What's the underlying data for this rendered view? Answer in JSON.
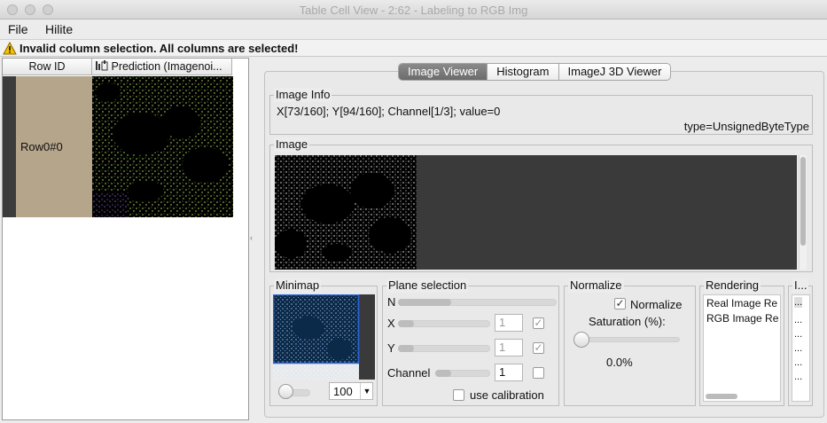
{
  "window": {
    "title": "Table Cell View - 2:62 - Labeling to RGB Img"
  },
  "menu": {
    "items": [
      "File",
      "Hilite"
    ]
  },
  "warning": {
    "text": "Invalid column selection. All columns are selected!"
  },
  "table": {
    "columns": [
      "Row ID",
      "Prediction (Imagenoi..."
    ],
    "rows": [
      {
        "id": "Row0#0"
      }
    ]
  },
  "tabs": {
    "items": [
      "Image Viewer",
      "Histogram",
      "ImageJ 3D Viewer"
    ],
    "selected": 0
  },
  "image_info": {
    "label": "Image Info",
    "line": "X[73/160]; Y[94/160]; Channel[1/3]; value=0",
    "type": "type=UnsignedByteType"
  },
  "image_panel": {
    "label": "Image"
  },
  "minimap": {
    "label": "Minimap",
    "zoom_value": "100"
  },
  "plane_selection": {
    "label": "Plane selection",
    "rows": [
      {
        "name": "N",
        "value": "",
        "checked": false,
        "has_spinner": false
      },
      {
        "name": "X",
        "value": "1",
        "checked": true,
        "has_spinner": true,
        "disabled": true
      },
      {
        "name": "Y",
        "value": "1",
        "checked": true,
        "has_spinner": true,
        "disabled": true
      },
      {
        "name": "Channel",
        "value": "1",
        "checked": false,
        "has_spinner": true,
        "disabled": false
      }
    ],
    "use_calibration_label": "use calibration"
  },
  "normalize": {
    "label": "Normalize",
    "checkbox_label": "Normalize",
    "saturation_label": "Saturation (%):",
    "saturation_value": "0.0%"
  },
  "rendering": {
    "label": "Rendering",
    "items": [
      "Real Image Re",
      "RGB Image Re"
    ]
  },
  "info_panel": {
    "label": "I...",
    "items": [
      "...",
      "...",
      "...",
      "...",
      "...",
      "..."
    ]
  },
  "colors": {
    "row_bg": "#b5a58a",
    "tab_selected": "#7b7b7b",
    "image_bg": "#3a3a3a"
  }
}
